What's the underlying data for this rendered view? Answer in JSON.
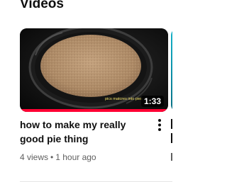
{
  "section": {
    "title": "Videos"
  },
  "video": {
    "title": "how to make my really good pie thing",
    "duration": "1:33",
    "watch_progress": 1.0,
    "views": "4 views",
    "separator": "•",
    "uploaded": "1 hour ago",
    "thumbnail_caption": "pics matcres into pies",
    "menu_icon": "more-vert-icon"
  },
  "colors": {
    "progress": "#ff0033",
    "title_text": "#0f0f0f",
    "meta_text": "#606060",
    "next_thumb_accent": "#16b3c9"
  }
}
